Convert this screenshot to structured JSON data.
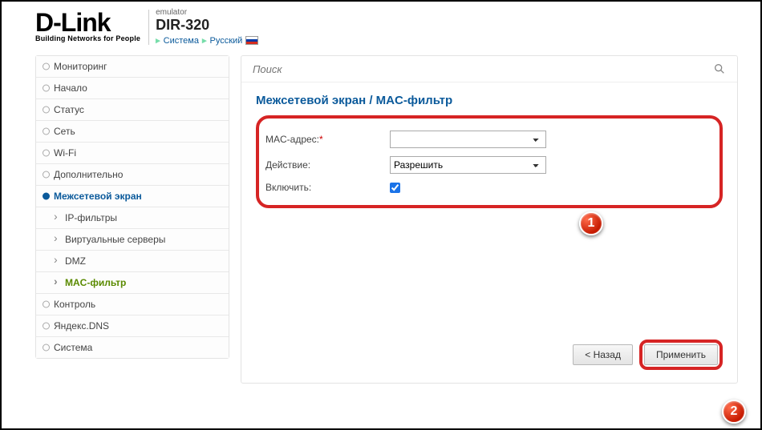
{
  "header": {
    "logo_text": "D-Link",
    "logo_tagline": "Building Networks for People",
    "emulator_label": "emulator",
    "model": "DIR-320",
    "crumb_system": "Система",
    "crumb_lang": "Русский"
  },
  "sidebar": {
    "items": [
      "Мониторинг",
      "Начало",
      "Статус",
      "Сеть",
      "Wi-Fi",
      "Дополнительно",
      "Межсетевой экран",
      "IP-фильтры",
      "Виртуальные серверы",
      "DMZ",
      "MAC-фильтр",
      "Контроль",
      "Яндекс.DNS",
      "Система"
    ]
  },
  "search": {
    "placeholder": "Поиск"
  },
  "main": {
    "title": "Межсетевой экран /  MAC-фильтр",
    "form": {
      "mac_label": "MAC-адрес:",
      "mac_value": "",
      "action_label": "Действие:",
      "action_value": "Разрешить",
      "enable_label": "Включить:",
      "enable_checked": true
    },
    "buttons": {
      "back": "< Назад",
      "apply": "Применить"
    }
  },
  "callouts": {
    "one": "1",
    "two": "2"
  }
}
